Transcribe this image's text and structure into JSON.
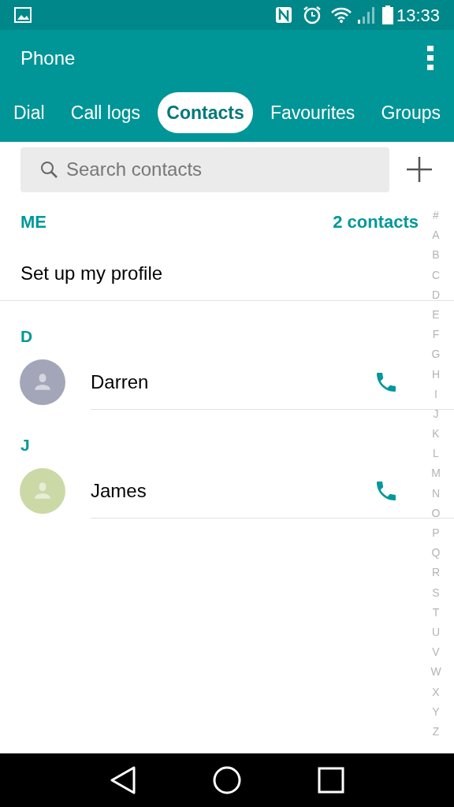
{
  "status_bar": {
    "time": "13:33"
  },
  "app_bar": {
    "title": "Phone"
  },
  "tabs": [
    {
      "label": "Dial",
      "selected": false
    },
    {
      "label": "Call logs",
      "selected": false
    },
    {
      "label": "Contacts",
      "selected": true
    },
    {
      "label": "Favourites",
      "selected": false
    },
    {
      "label": "Groups",
      "selected": false
    }
  ],
  "search": {
    "placeholder": "Search contacts"
  },
  "me_section": {
    "header": "ME",
    "count": "2 contacts",
    "profile": "Set up my profile"
  },
  "sections": [
    {
      "letter": "D",
      "contacts": [
        {
          "name": "Darren",
          "color": "#a3a6b8"
        }
      ]
    },
    {
      "letter": "J",
      "contacts": [
        {
          "name": "James",
          "color": "#cbd9a6"
        }
      ]
    }
  ],
  "index": [
    "#",
    "A",
    "B",
    "C",
    "D",
    "E",
    "F",
    "G",
    "H",
    "I",
    "J",
    "K",
    "L",
    "M",
    "N",
    "O",
    "P",
    "Q",
    "R",
    "S",
    "T",
    "U",
    "V",
    "W",
    "X",
    "Y",
    "Z"
  ]
}
